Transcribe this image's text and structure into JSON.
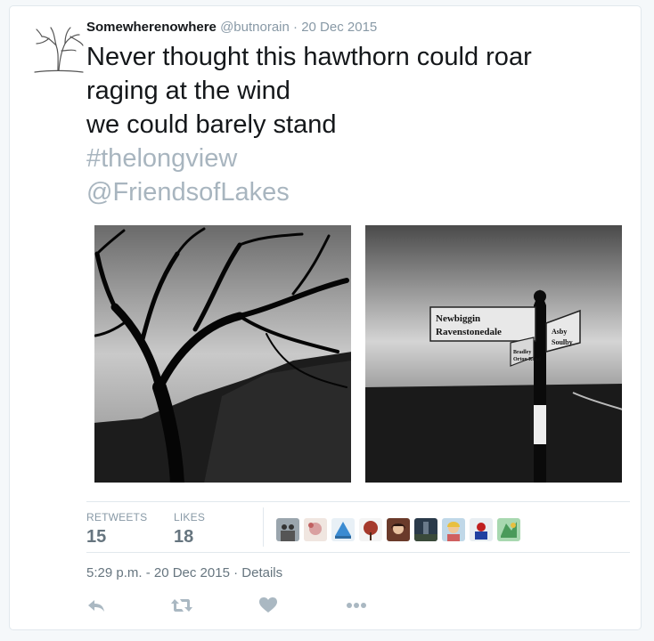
{
  "tweet": {
    "author_name": "Somewherenowhere",
    "author_handle": "@butnorain",
    "separator": "·",
    "date": "20 Dec 2015",
    "text_lines": [
      "Never thought this hawthorn could roar",
      "raging at the wind",
      "we could barely stand"
    ],
    "hashtag": "#thelongview",
    "mention": "@FriendsofLakes"
  },
  "media": {
    "photo_left": "tree-photo",
    "photo_right": "signpost-photo",
    "sign_line_1": "Newbiggin",
    "sign_line_2": "Ravenstonedale",
    "sign_arm_small_1": "Asby",
    "sign_arm_small_2": "Soulby",
    "sign_arm_side_1": "Bradley",
    "sign_arm_side_2": "Orton Road"
  },
  "stats": {
    "retweets_label": "RETWEETS",
    "retweets_count": "15",
    "likes_label": "LIKES",
    "likes_count": "18"
  },
  "likers": [
    "liker-1",
    "liker-2",
    "liker-3",
    "liker-4",
    "liker-5",
    "liker-6",
    "liker-7",
    "liker-8",
    "liker-9"
  ],
  "timestamp": {
    "time": "5:29 p.m. - 20 Dec 2015",
    "separator": " · ",
    "details_label": "Details"
  },
  "actions": {
    "reply_icon": "reply-icon",
    "retweet_icon": "retweet-icon",
    "like_icon": "heart-icon",
    "more_icon": "more-icon"
  },
  "colors": {
    "name": "#14171a",
    "meta": "#8899a6",
    "hashtag": "#a8b5bf",
    "action_icon": "#aab8c2",
    "border": "#e1e8ed"
  }
}
